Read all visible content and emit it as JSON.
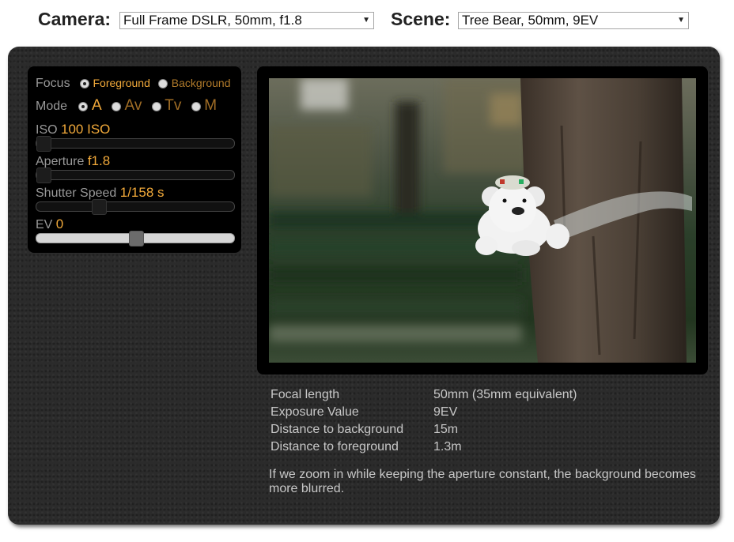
{
  "camera": {
    "label": "Camera:",
    "value": "Full Frame DSLR, 50mm, f1.8"
  },
  "scene": {
    "label": "Scene:",
    "value": "Tree Bear, 50mm, 9EV"
  },
  "controls": {
    "focus": {
      "label": "Focus",
      "options": [
        "Foreground",
        "Background"
      ],
      "selected": "Foreground"
    },
    "mode": {
      "label": "Mode",
      "options": [
        "A",
        "Av",
        "Tv",
        "M"
      ],
      "selected": "A"
    },
    "iso": {
      "label": "ISO",
      "value": "100 ISO",
      "level": 0.0
    },
    "aperture": {
      "label": "Aperture",
      "value": "f1.8",
      "level": 0.0
    },
    "shutter": {
      "label": "Shutter Speed",
      "value": "1/158 s",
      "level": 0.3
    },
    "ev": {
      "label": "EV",
      "value": "0",
      "level": 0.5
    }
  },
  "info": [
    {
      "key": "Focal length",
      "value": "50mm (35mm equivalent)"
    },
    {
      "key": "Exposure Value",
      "value": "9EV"
    },
    {
      "key": "Distance to background",
      "value": "15m"
    },
    {
      "key": "Distance to foreground",
      "value": "1.3m"
    }
  ],
  "description": "If we zoom in while keeping the aperture constant, the background becomes more blurred.",
  "colors": {
    "accent": "#f1a93a",
    "panel": "#2b2b2b"
  }
}
